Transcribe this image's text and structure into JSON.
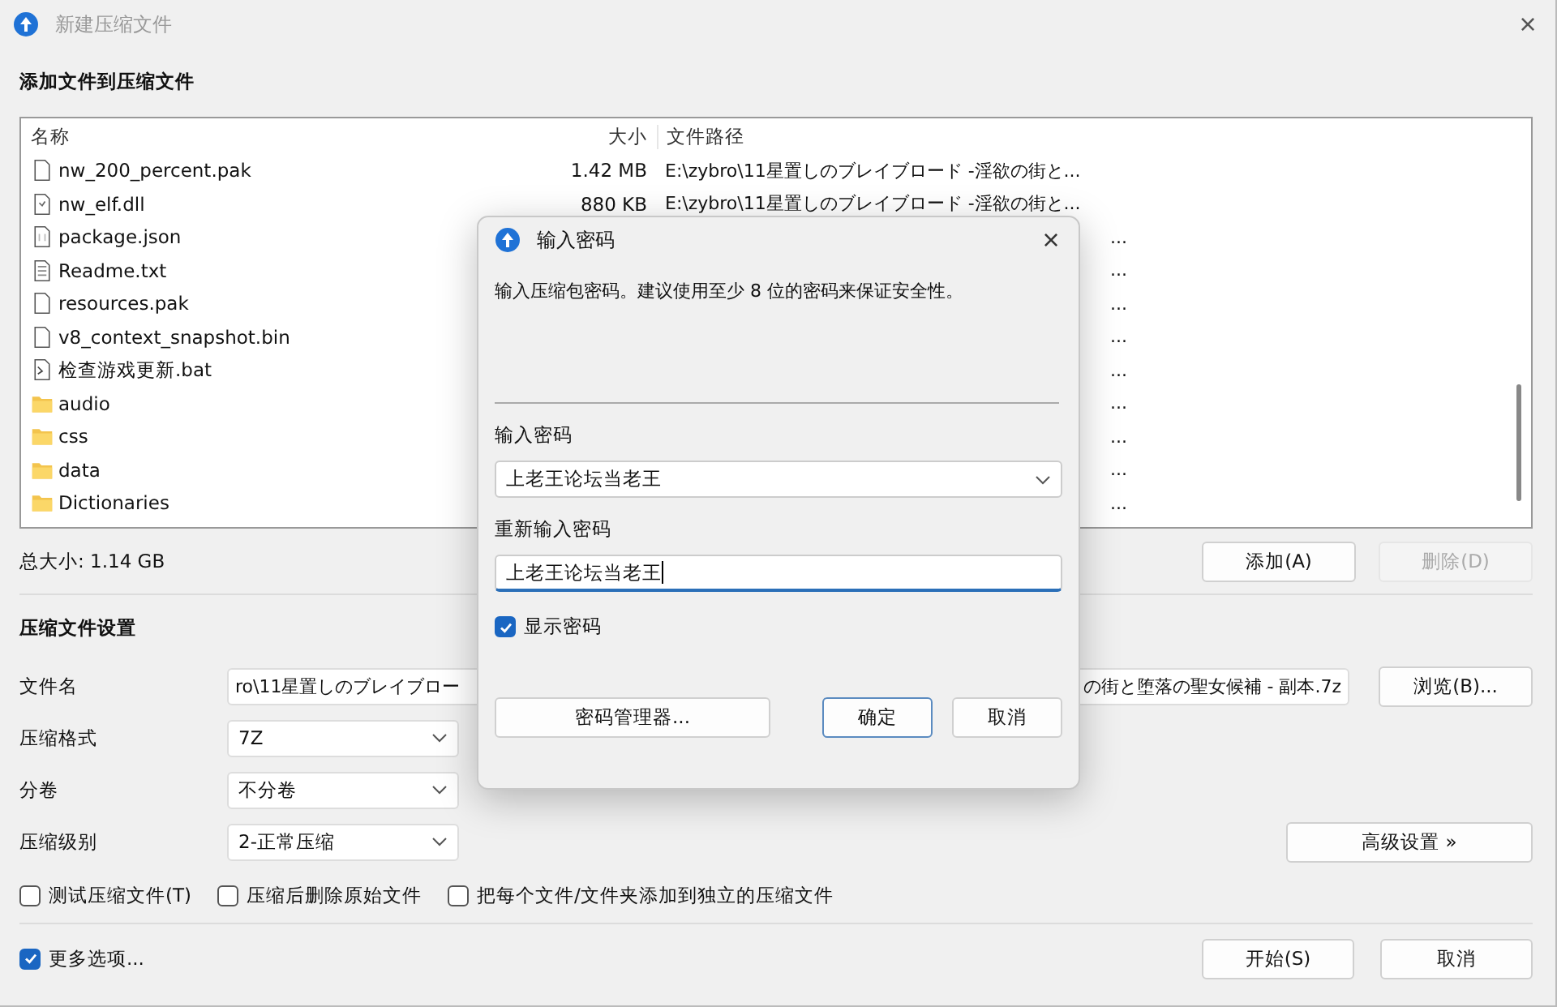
{
  "window": {
    "title": "新建压缩文件",
    "active": false,
    "close": "×"
  },
  "add_section": {
    "heading": "添加文件到压缩文件"
  },
  "file_list": {
    "columns": [
      "名称",
      "大小",
      "文件路径"
    ],
    "rows": [
      {
        "kind": "file",
        "name": "nw_200_percent.pak",
        "size": "1.42 MB",
        "path": "E:\\zybro\\11星置しのブレイブロード -淫欲の街と..."
      },
      {
        "kind": "dll",
        "name": "nw_elf.dll",
        "size": "880 KB",
        "path": "E:\\zybro\\11星置しのブレイブロード -淫欲の街と..."
      },
      {
        "kind": "json",
        "name": "package.json",
        "path": "..."
      },
      {
        "kind": "text",
        "name": "Readme.txt",
        "path": "..."
      },
      {
        "kind": "file",
        "name": "resources.pak",
        "path": "..."
      },
      {
        "kind": "file",
        "name": "v8_context_snapshot.bin",
        "path": "..."
      },
      {
        "kind": "bat",
        "name": "检查游戏更新.bat",
        "path": "..."
      },
      {
        "kind": "folder",
        "name": "audio",
        "path": "..."
      },
      {
        "kind": "folder",
        "name": "css",
        "path": "..."
      },
      {
        "kind": "folder",
        "name": "data",
        "path": "..."
      },
      {
        "kind": "folder",
        "name": "Dictionaries",
        "path": "..."
      }
    ]
  },
  "total_size": "总大小: 1.14 GB",
  "list_buttons": [
    {
      "label": "添加(A)",
      "disabled": false
    },
    {
      "label": "删除(D)",
      "disabled": true
    }
  ],
  "settings": {
    "heading": "压缩文件设置",
    "filename": {
      "label": "文件名",
      "value_start": "ro\\11星置しのブレイブロー",
      "value_end": "の街と堕落の聖女候補 - 副本.7z",
      "browse": "浏览(B)..."
    },
    "selects": [
      {
        "label": "压缩格式",
        "value": "7Z"
      },
      {
        "label": "分卷",
        "value": "不分卷"
      },
      {
        "label": "压缩级别",
        "value": "2-正常压缩"
      }
    ],
    "advanced": "高级设置 »",
    "options": [
      {
        "label": "测试压缩文件(T)",
        "checked": false
      },
      {
        "label": "压缩后删除原始文件",
        "checked": false
      },
      {
        "label": "把每个文件/文件夹添加到独立的压缩文件",
        "checked": false
      }
    ]
  },
  "more_options": {
    "label": "更多选项...",
    "checked": true
  },
  "footer_buttons": [
    "开始(S)",
    "取消"
  ],
  "password_dialog": {
    "title": "输入密码",
    "close": "×",
    "description": "输入压缩包密码。建议使用至少 8 位的密码来保证安全性。",
    "password": {
      "label": "输入密码",
      "value": "上老王论坛当老王"
    },
    "confirm": {
      "label": "重新输入密码",
      "value": "上老王论坛当老王"
    },
    "show_password": {
      "label": "显示密码",
      "checked": true
    },
    "buttons": [
      {
        "label": "密码管理器...",
        "default": false
      },
      {
        "label": "确定",
        "default": true
      },
      {
        "label": "取消",
        "default": false
      }
    ]
  }
}
